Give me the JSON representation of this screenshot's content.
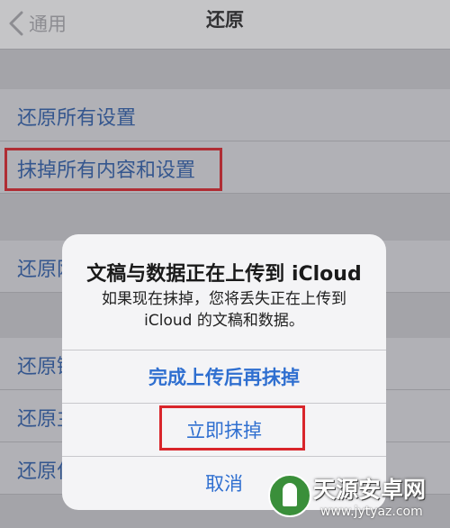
{
  "nav": {
    "back_label": "通用",
    "title": "还原"
  },
  "list": {
    "items": [
      {
        "label": "还原所有设置"
      },
      {
        "label": "抹掉所有内容和设置"
      },
      {
        "label": "还原网络设置"
      },
      {
        "label": "还原键盘字典"
      },
      {
        "label": "还原主屏幕布局"
      },
      {
        "label": "还原位置与隐私"
      }
    ]
  },
  "alert": {
    "title": "文稿与数据正在上传到 iCloud",
    "message_line1": "如果现在抹掉，您将丢失正在上传到",
    "message_line2": "iCloud 的文稿和数据。",
    "button_wait": "完成上传后再抹掉",
    "button_erase_now": "立即抹掉",
    "button_cancel": "取消"
  },
  "watermark": {
    "name": "天源安卓网",
    "url": "www.jytyaz.com"
  },
  "colors": {
    "accent": "#2f6fd0",
    "highlight": "#d9252b",
    "list_text": "#2f5ea8"
  }
}
